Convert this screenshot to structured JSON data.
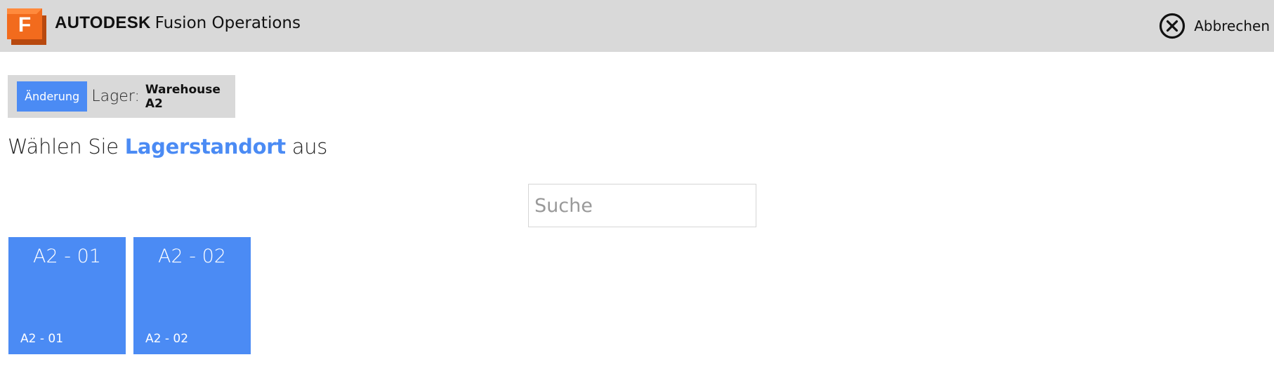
{
  "header": {
    "logo_letter": "F",
    "brand_company": "AUTODESK",
    "brand_product": "Fusion Operations",
    "cancel_label": "Abbrechen",
    "cancel_icon": "close-circle-icon"
  },
  "warehouse": {
    "change_button_label": "Änderung",
    "label": "Lager:",
    "value": "Warehouse A2"
  },
  "heading": {
    "prefix": "Wählen Sie",
    "highlight": "Lagerstandort",
    "suffix": "aus"
  },
  "search": {
    "placeholder": "Suche",
    "value": ""
  },
  "locations": [
    {
      "title": "A2 - 01",
      "subtitle": "A2 - 01"
    },
    {
      "title": "A2 - 02",
      "subtitle": "A2 - 02"
    }
  ],
  "colors": {
    "accent": "#4b8bf4",
    "header_bg": "#d9d9d9",
    "logo_orange": "#f26b1d"
  }
}
